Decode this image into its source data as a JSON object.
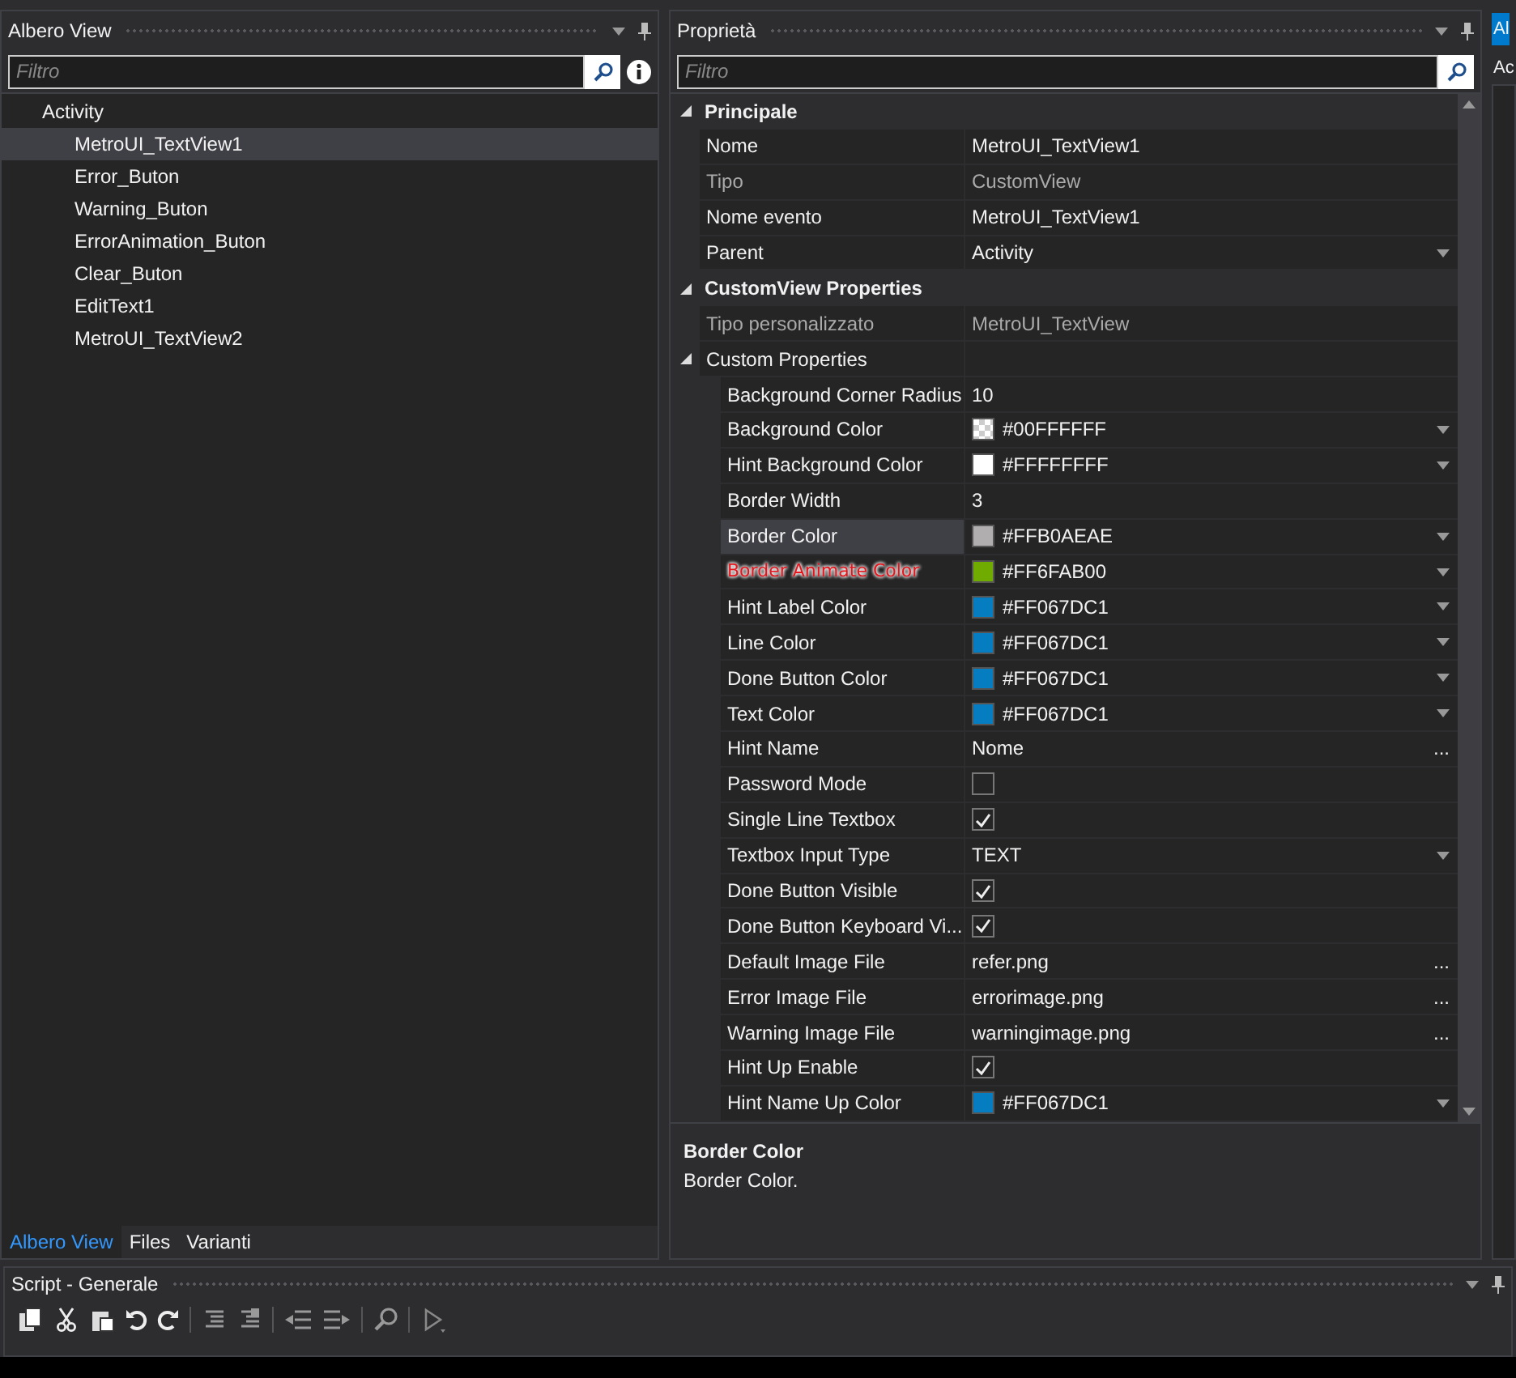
{
  "tree_panel": {
    "title": "Albero View",
    "filter": {
      "placeholder": "Filtro"
    },
    "tree": [
      {
        "label": "Activity",
        "selected": false,
        "children": [
          {
            "label": "MetroUI_TextView1",
            "selected": true
          },
          {
            "label": "Error_Buton",
            "selected": false
          },
          {
            "label": "Warning_Buton",
            "selected": false
          },
          {
            "label": "ErrorAnimation_Buton",
            "selected": false
          },
          {
            "label": "Clear_Buton",
            "selected": false
          },
          {
            "label": "EditText1",
            "selected": false
          },
          {
            "label": "MetroUI_TextView2",
            "selected": false
          }
        ]
      }
    ],
    "tabs": [
      {
        "label": "Albero View",
        "selected": true
      },
      {
        "label": "Files",
        "selected": false
      },
      {
        "label": "Varianti",
        "selected": false
      }
    ]
  },
  "properties_panel": {
    "title": "Proprietà",
    "filter": {
      "placeholder": "Filtro"
    },
    "sections": [
      {
        "title": "Principale",
        "expanded": true,
        "rows": [
          {
            "kind": "text",
            "name": "Nome",
            "value": "MetroUI_TextView1",
            "disabled": false,
            "selected": false
          },
          {
            "kind": "text",
            "name": "Tipo",
            "value": "CustomView",
            "disabled": true,
            "selected": false
          },
          {
            "kind": "text",
            "name": "Nome evento",
            "value": "MetroUI_TextView1",
            "disabled": false,
            "selected": false
          },
          {
            "kind": "dropdown",
            "name": "Parent",
            "value": "Activity",
            "disabled": false,
            "selected": false
          }
        ]
      },
      {
        "title": "CustomView Properties",
        "expanded": true,
        "rows": [
          {
            "kind": "text",
            "name": "Tipo personalizzato",
            "value": "MetroUI_TextView",
            "disabled": true,
            "selected": false
          },
          {
            "kind": "group",
            "name": "Custom Properties",
            "expanded": true,
            "children": [
              {
                "kind": "text",
                "name": "Background Corner Radius",
                "value": "10",
                "selected": false
              },
              {
                "kind": "color",
                "name": "Background Color",
                "value": "#00FFFFFF",
                "color": "#ffffff",
                "transparent": true,
                "selected": false
              },
              {
                "kind": "color",
                "name": "Hint Background Color",
                "value": "#FFFFFFFF",
                "color": "#ffffff",
                "transparent": false,
                "selected": false
              },
              {
                "kind": "text",
                "name": "Border Width",
                "value": "3",
                "selected": false
              },
              {
                "kind": "color",
                "name": "Border Color",
                "value": "#FFB0AEAE",
                "color": "#b0aeae",
                "transparent": false,
                "selected": true
              },
              {
                "kind": "color",
                "name": "Border Animate Color",
                "value": "#FF6FAB00",
                "color": "#6fab00",
                "transparent": false,
                "selected": false,
                "dragging": true
              },
              {
                "kind": "color",
                "name": "Hint Label Color",
                "value": "#FF067DC1",
                "color": "#067dc1",
                "transparent": false,
                "selected": false
              },
              {
                "kind": "color",
                "name": "Line Color",
                "value": "#FF067DC1",
                "color": "#067dc1",
                "transparent": false,
                "selected": false
              },
              {
                "kind": "color",
                "name": "Done Button Color",
                "value": "#FF067DC1",
                "color": "#067dc1",
                "transparent": false,
                "selected": false
              },
              {
                "kind": "color",
                "name": "Text Color",
                "value": "#FF067DC1",
                "color": "#067dc1",
                "transparent": false,
                "selected": false
              },
              {
                "kind": "file",
                "name": "Hint Name",
                "value": "Nome",
                "button": "...",
                "selected": false
              },
              {
                "kind": "check",
                "name": "Password Mode",
                "checked": false,
                "selected": false
              },
              {
                "kind": "check",
                "name": "Single Line Textbox",
                "checked": true,
                "selected": false
              },
              {
                "kind": "dropdown",
                "name": "Textbox Input Type",
                "value": "TEXT",
                "selected": false
              },
              {
                "kind": "check",
                "name": "Done Button Visible",
                "checked": true,
                "selected": false
              },
              {
                "kind": "check",
                "name": "Done Button Keyboard Vi...",
                "checked": true,
                "selected": false
              },
              {
                "kind": "file",
                "name": "Default Image File",
                "value": "refer.png",
                "button": "...",
                "selected": false
              },
              {
                "kind": "file",
                "name": "Error Image File",
                "value": "errorimage.png",
                "button": "...",
                "selected": false
              },
              {
                "kind": "file",
                "name": "Warning Image File",
                "value": "warningimage.png",
                "button": "...",
                "selected": false
              },
              {
                "kind": "check",
                "name": "Hint Up Enable",
                "checked": true,
                "selected": false
              },
              {
                "kind": "color",
                "name": "Hint Name Up Color",
                "value": "#FF067DC1",
                "color": "#067dc1",
                "transparent": false,
                "selected": false
              }
            ]
          }
        ]
      }
    ],
    "description": {
      "title": "Border Color",
      "text": "Border Color."
    }
  },
  "right_panel": {
    "tab": "Al",
    "label": "Ac"
  },
  "script_panel": {
    "title": "Script - Generale"
  }
}
